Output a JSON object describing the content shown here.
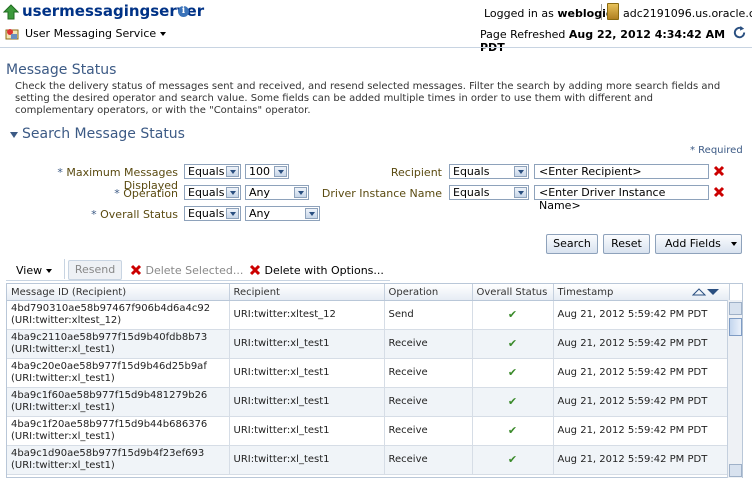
{
  "header": {
    "app_title": "usermessagingserver",
    "logged_in_prefix": "Logged in as",
    "user": "weblogic",
    "host": "adc2191096.us.oracle.com",
    "service_menu": "User Messaging Service",
    "refreshed_prefix": "Page Refreshed",
    "refreshed_time": "Aug 22, 2012 4:34:42 AM PDT"
  },
  "page": {
    "title": "Message Status",
    "description": "Check the delivery status of messages sent and received, and resend selected messages. Filter the search by adding more search fields and setting the desired operator and search value. Some fields can be added multiple times in order to use them with different and complementary operators, or with the \"Contains\" operator."
  },
  "search": {
    "title": "Search Message Status",
    "required_note": "* Required",
    "fields": {
      "max_messages": {
        "label": "Maximum Messages Displayed",
        "operator": "Equals",
        "value": "100"
      },
      "operation": {
        "label": "Operation",
        "operator": "Equals",
        "value": "Any"
      },
      "overall_status": {
        "label": "Overall Status",
        "operator": "Equals",
        "value": "Any"
      },
      "recipient": {
        "label": "Recipient",
        "operator": "Equals",
        "placeholder": "<Enter Recipient>"
      },
      "driver_instance": {
        "label": "Driver Instance Name",
        "operator": "Equals",
        "placeholder": "<Enter Driver Instance Name>"
      }
    },
    "buttons": {
      "search": "Search",
      "reset": "Reset",
      "add_fields": "Add Fields"
    }
  },
  "toolbar": {
    "view": "View",
    "resend": "Resend",
    "delete_selected": "Delete Selected...",
    "delete_options": "Delete with Options..."
  },
  "table": {
    "columns": [
      "Message ID (Recipient)",
      "Recipient",
      "Operation",
      "Overall Status",
      "Timestamp"
    ],
    "rows": [
      {
        "id": "4bd790310ae58b97467f906b4d6a4c92",
        "uri": "(URI:twitter:xltest_12)",
        "recipient": "URI:twitter:xltest_12",
        "operation": "Send",
        "timestamp": "Aug 21, 2012 5:59:42 PM PDT"
      },
      {
        "id": "4ba9c2110ae58b977f15d9b40fdb8b73",
        "uri": "(URI:twitter:xl_test1)",
        "recipient": "URI:twitter:xl_test1",
        "operation": "Receive",
        "timestamp": "Aug 21, 2012 5:59:42 PM PDT"
      },
      {
        "id": "4ba9c20e0ae58b977f15d9b46d25b9af",
        "uri": "(URI:twitter:xl_test1)",
        "recipient": "URI:twitter:xl_test1",
        "operation": "Receive",
        "timestamp": "Aug 21, 2012 5:59:42 PM PDT"
      },
      {
        "id": "4ba9c1f60ae58b977f15d9b481279b26",
        "uri": "(URI:twitter:xl_test1)",
        "recipient": "URI:twitter:xl_test1",
        "operation": "Receive",
        "timestamp": "Aug 21, 2012 5:59:42 PM PDT"
      },
      {
        "id": "4ba9c1f20ae58b977f15d9b44b686376",
        "uri": "(URI:twitter:xl_test1)",
        "recipient": "URI:twitter:xl_test1",
        "operation": "Receive",
        "timestamp": "Aug 21, 2012 5:59:42 PM PDT"
      },
      {
        "id": "4ba9c1d90ae58b977f15d9b4f23ef693",
        "uri": "(URI:twitter:xl_test1)",
        "recipient": "URI:twitter:xl_test1",
        "operation": "Receive",
        "timestamp": "Aug 21, 2012 5:59:42 PM PDT"
      }
    ],
    "status_icon": "check-icon"
  },
  "colors": {
    "accent": "#003286",
    "heading": "#3c5a85",
    "label": "#5a4a10",
    "error": "#cc0000",
    "ok": "#3a8a2a"
  }
}
